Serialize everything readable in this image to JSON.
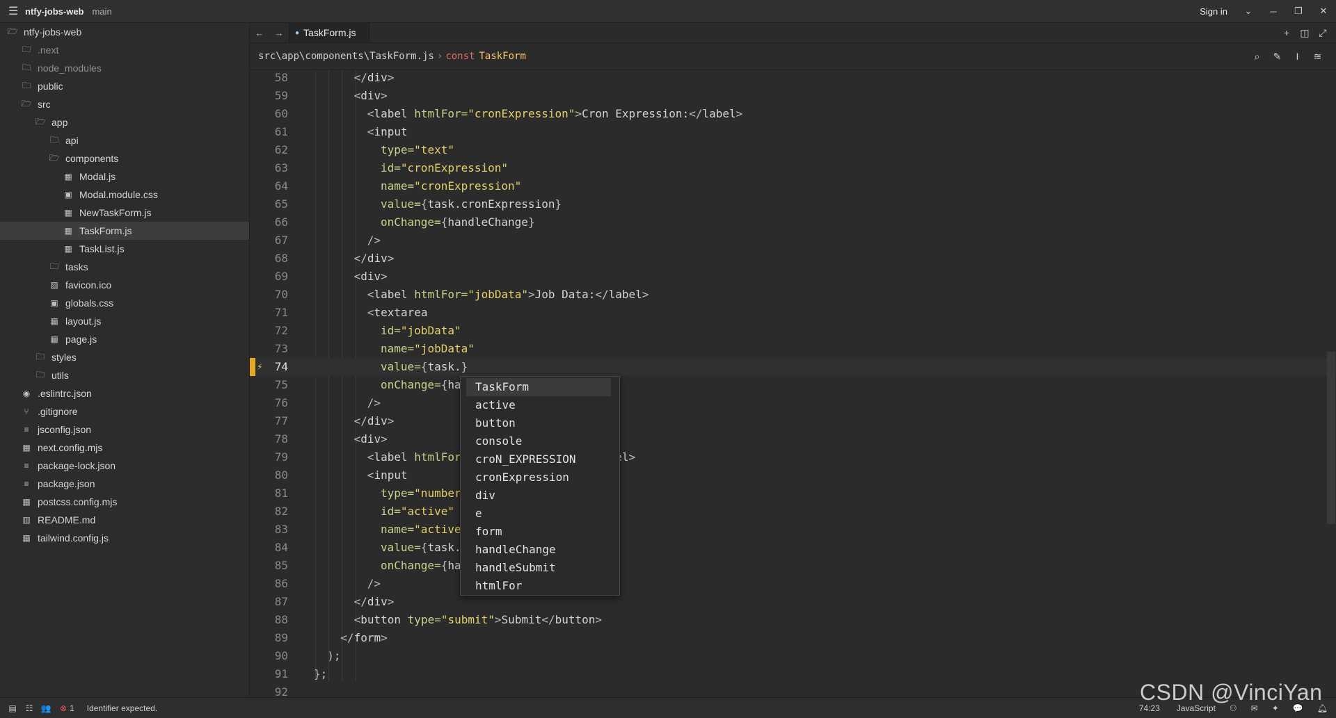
{
  "titlebar": {
    "project": "ntfy-jobs-web",
    "branch": "main",
    "sign_in": "Sign in"
  },
  "sidebar": {
    "root": "ntfy-jobs-web",
    "items": [
      {
        "label": ".next",
        "depth": 1,
        "icon": "folder-icon",
        "dim": true
      },
      {
        "label": "node_modules",
        "depth": 1,
        "icon": "folder-icon",
        "dim": true
      },
      {
        "label": "public",
        "depth": 1,
        "icon": "folder-icon"
      },
      {
        "label": "src",
        "depth": 1,
        "icon": "folder-open-icon"
      },
      {
        "label": "app",
        "depth": 2,
        "icon": "folder-open-icon"
      },
      {
        "label": "api",
        "depth": 3,
        "icon": "folder-icon"
      },
      {
        "label": "components",
        "depth": 3,
        "icon": "folder-open-icon"
      },
      {
        "label": "Modal.js",
        "depth": 4,
        "icon": "js-file-icon"
      },
      {
        "label": "Modal.module.css",
        "depth": 4,
        "icon": "css-file-icon"
      },
      {
        "label": "NewTaskForm.js",
        "depth": 4,
        "icon": "js-file-icon"
      },
      {
        "label": "TaskForm.js",
        "depth": 4,
        "icon": "js-file-icon",
        "selected": true
      },
      {
        "label": "TaskList.js",
        "depth": 4,
        "icon": "js-file-icon"
      },
      {
        "label": "tasks",
        "depth": 3,
        "icon": "folder-icon"
      },
      {
        "label": "favicon.ico",
        "depth": 3,
        "icon": "image-file-icon"
      },
      {
        "label": "globals.css",
        "depth": 3,
        "icon": "css-file-icon"
      },
      {
        "label": "layout.js",
        "depth": 3,
        "icon": "js-file-icon"
      },
      {
        "label": "page.js",
        "depth": 3,
        "icon": "js-file-icon"
      },
      {
        "label": "styles",
        "depth": 2,
        "icon": "folder-icon"
      },
      {
        "label": "utils",
        "depth": 2,
        "icon": "folder-icon"
      },
      {
        "label": ".eslintrc.json",
        "depth": 1,
        "icon": "settings-file-icon"
      },
      {
        "label": ".gitignore",
        "depth": 1,
        "icon": "git-icon"
      },
      {
        "label": "jsconfig.json",
        "depth": 1,
        "icon": "json-file-icon"
      },
      {
        "label": "next.config.mjs",
        "depth": 1,
        "icon": "js-file-icon"
      },
      {
        "label": "package-lock.json",
        "depth": 1,
        "icon": "json-file-icon"
      },
      {
        "label": "package.json",
        "depth": 1,
        "icon": "json-file-icon"
      },
      {
        "label": "postcss.config.mjs",
        "depth": 1,
        "icon": "js-file-icon"
      },
      {
        "label": "README.md",
        "depth": 1,
        "icon": "markdown-file-icon"
      },
      {
        "label": "tailwind.config.js",
        "depth": 1,
        "icon": "js-file-icon"
      }
    ]
  },
  "tabs": [
    {
      "label": "TaskForm.js",
      "active": true
    }
  ],
  "breadcrumb": {
    "path": "src\\app\\components\\TaskForm.js",
    "keyword": "const",
    "symbol": "TaskForm"
  },
  "editor": {
    "current_line": 74,
    "lines": [
      {
        "n": "58",
        "indent": 3,
        "parts": [
          [
            "t-punct",
            "</"
          ],
          [
            "t-tag",
            "div"
          ],
          [
            "t-punct",
            ">"
          ]
        ]
      },
      {
        "n": "59",
        "indent": 3,
        "parts": [
          [
            "t-punct",
            "<"
          ],
          [
            "t-tag",
            "div"
          ],
          [
            "t-punct",
            ">"
          ]
        ]
      },
      {
        "n": "60",
        "indent": 4,
        "parts": [
          [
            "t-punct",
            "<"
          ],
          [
            "t-tag",
            "label "
          ],
          [
            "t-attr",
            "htmlFor="
          ],
          [
            "t-str",
            "\"cronExpression\""
          ],
          [
            "t-punct",
            ">"
          ],
          [
            "t-id",
            "Cron Expression:"
          ],
          [
            "t-punct",
            "</"
          ],
          [
            "t-tag",
            "label"
          ],
          [
            "t-punct",
            ">"
          ]
        ]
      },
      {
        "n": "61",
        "indent": 4,
        "parts": [
          [
            "t-punct",
            "<"
          ],
          [
            "t-tag",
            "input"
          ]
        ]
      },
      {
        "n": "62",
        "indent": 5,
        "parts": [
          [
            "t-attr",
            "type="
          ],
          [
            "t-str",
            "\"text\""
          ]
        ]
      },
      {
        "n": "63",
        "indent": 5,
        "parts": [
          [
            "t-attr",
            "id="
          ],
          [
            "t-str",
            "\"cronExpression\""
          ]
        ]
      },
      {
        "n": "64",
        "indent": 5,
        "parts": [
          [
            "t-attr",
            "name="
          ],
          [
            "t-str",
            "\"cronExpression\""
          ]
        ]
      },
      {
        "n": "65",
        "indent": 5,
        "parts": [
          [
            "t-attr",
            "value="
          ],
          [
            "t-punct",
            "{"
          ],
          [
            "t-id",
            "task.cronExpression"
          ],
          [
            "t-punct",
            "}"
          ]
        ]
      },
      {
        "n": "66",
        "indent": 5,
        "parts": [
          [
            "t-attr",
            "onChange="
          ],
          [
            "t-punct",
            "{"
          ],
          [
            "t-id",
            "handleChange"
          ],
          [
            "t-punct",
            "}"
          ]
        ]
      },
      {
        "n": "67",
        "indent": 4,
        "parts": [
          [
            "t-punct",
            "/>"
          ]
        ]
      },
      {
        "n": "68",
        "indent": 3,
        "parts": [
          [
            "t-punct",
            "</"
          ],
          [
            "t-tag",
            "div"
          ],
          [
            "t-punct",
            ">"
          ]
        ]
      },
      {
        "n": "69",
        "indent": 3,
        "parts": [
          [
            "t-punct",
            "<"
          ],
          [
            "t-tag",
            "div"
          ],
          [
            "t-punct",
            ">"
          ]
        ]
      },
      {
        "n": "70",
        "indent": 4,
        "parts": [
          [
            "t-punct",
            "<"
          ],
          [
            "t-tag",
            "label "
          ],
          [
            "t-attr",
            "htmlFor="
          ],
          [
            "t-str",
            "\"jobData\""
          ],
          [
            "t-punct",
            ">"
          ],
          [
            "t-id",
            "Job Data:"
          ],
          [
            "t-punct",
            "</"
          ],
          [
            "t-tag",
            "label"
          ],
          [
            "t-punct",
            ">"
          ]
        ]
      },
      {
        "n": "71",
        "indent": 4,
        "parts": [
          [
            "t-punct",
            "<"
          ],
          [
            "t-tag",
            "textarea"
          ]
        ]
      },
      {
        "n": "72",
        "indent": 5,
        "parts": [
          [
            "t-attr",
            "id="
          ],
          [
            "t-str",
            "\"jobData\""
          ]
        ]
      },
      {
        "n": "73",
        "indent": 5,
        "parts": [
          [
            "t-attr",
            "name="
          ],
          [
            "t-str",
            "\"jobData\""
          ]
        ]
      },
      {
        "n": "74",
        "indent": 5,
        "parts": [
          [
            "t-attr",
            "value="
          ],
          [
            "t-punct",
            "{"
          ],
          [
            "t-id",
            "task."
          ],
          [
            "t-punct",
            "}"
          ]
        ]
      },
      {
        "n": "75",
        "indent": 5,
        "parts": [
          [
            "t-attr",
            "onChange="
          ],
          [
            "t-punct",
            "{"
          ],
          [
            "t-id",
            "ha"
          ]
        ]
      },
      {
        "n": "76",
        "indent": 4,
        "parts": [
          [
            "t-punct",
            "/>"
          ]
        ]
      },
      {
        "n": "77",
        "indent": 3,
        "parts": [
          [
            "t-punct",
            "</"
          ],
          [
            "t-tag",
            "div"
          ],
          [
            "t-punct",
            ">"
          ]
        ]
      },
      {
        "n": "78",
        "indent": 3,
        "parts": [
          [
            "t-punct",
            "<"
          ],
          [
            "t-tag",
            "div"
          ],
          [
            "t-punct",
            ">"
          ]
        ]
      },
      {
        "n": "79",
        "indent": 4,
        "parts": [
          [
            "t-punct",
            "<"
          ],
          [
            "t-tag",
            "label "
          ],
          [
            "t-attr",
            "htmlFor"
          ],
          [
            "t-id",
            "                "
          ],
          [
            "t-id",
            "):"
          ],
          [
            "t-punct",
            "</"
          ],
          [
            "t-tag",
            "label"
          ],
          [
            "t-punct",
            ">"
          ]
        ]
      },
      {
        "n": "80",
        "indent": 4,
        "parts": [
          [
            "t-punct",
            "<"
          ],
          [
            "t-tag",
            "input"
          ]
        ]
      },
      {
        "n": "81",
        "indent": 5,
        "parts": [
          [
            "t-attr",
            "type="
          ],
          [
            "t-str",
            "\"number"
          ]
        ]
      },
      {
        "n": "82",
        "indent": 5,
        "parts": [
          [
            "t-attr",
            "id="
          ],
          [
            "t-str",
            "\"active\""
          ]
        ]
      },
      {
        "n": "83",
        "indent": 5,
        "parts": [
          [
            "t-attr",
            "name="
          ],
          [
            "t-str",
            "\"active"
          ]
        ]
      },
      {
        "n": "84",
        "indent": 5,
        "parts": [
          [
            "t-attr",
            "value="
          ],
          [
            "t-punct",
            "{"
          ],
          [
            "t-id",
            "task."
          ]
        ]
      },
      {
        "n": "85",
        "indent": 5,
        "parts": [
          [
            "t-attr",
            "onChange="
          ],
          [
            "t-punct",
            "{"
          ],
          [
            "t-id",
            "ha"
          ]
        ]
      },
      {
        "n": "86",
        "indent": 4,
        "parts": [
          [
            "t-punct",
            "/>"
          ]
        ]
      },
      {
        "n": "87",
        "indent": 3,
        "parts": [
          [
            "t-punct",
            "</"
          ],
          [
            "t-tag",
            "div"
          ],
          [
            "t-punct",
            ">"
          ]
        ]
      },
      {
        "n": "88",
        "indent": 3,
        "parts": [
          [
            "t-punct",
            "<"
          ],
          [
            "t-tag",
            "button "
          ],
          [
            "t-attr",
            "type="
          ],
          [
            "t-str",
            "\"submit\""
          ],
          [
            "t-punct",
            ">"
          ],
          [
            "t-id",
            "Submit"
          ],
          [
            "t-punct",
            "</"
          ],
          [
            "t-tag",
            "button"
          ],
          [
            "t-punct",
            ">"
          ]
        ]
      },
      {
        "n": "89",
        "indent": 2,
        "parts": [
          [
            "t-punct",
            "</"
          ],
          [
            "t-tag",
            "form"
          ],
          [
            "t-punct",
            ">"
          ]
        ]
      },
      {
        "n": "90",
        "indent": 1,
        "parts": [
          [
            "t-punct",
            ");"
          ]
        ]
      },
      {
        "n": "91",
        "indent": 0,
        "parts": [
          [
            "t-punct",
            "};"
          ]
        ]
      },
      {
        "n": "92",
        "indent": 0,
        "parts": []
      }
    ]
  },
  "autocomplete": {
    "items": [
      "TaskForm",
      "active",
      "button",
      "console",
      "croN_EXPRESSION",
      "cronExpression",
      "div",
      "e",
      "form",
      "handleChange",
      "handleSubmit",
      "htmlFor"
    ],
    "selected_index": 0
  },
  "statusbar": {
    "error_count": "1",
    "message": "Identifier expected.",
    "position": "74:23",
    "language": "JavaScript"
  },
  "watermark": "CSDN @VinciYan",
  "colors": {
    "accent": "#e6a822",
    "error": "#e05a5a",
    "string": "#e5d06a",
    "attribute": "#c8d38a",
    "keyword": "#e06c60",
    "symbol": "#ffc66d"
  }
}
